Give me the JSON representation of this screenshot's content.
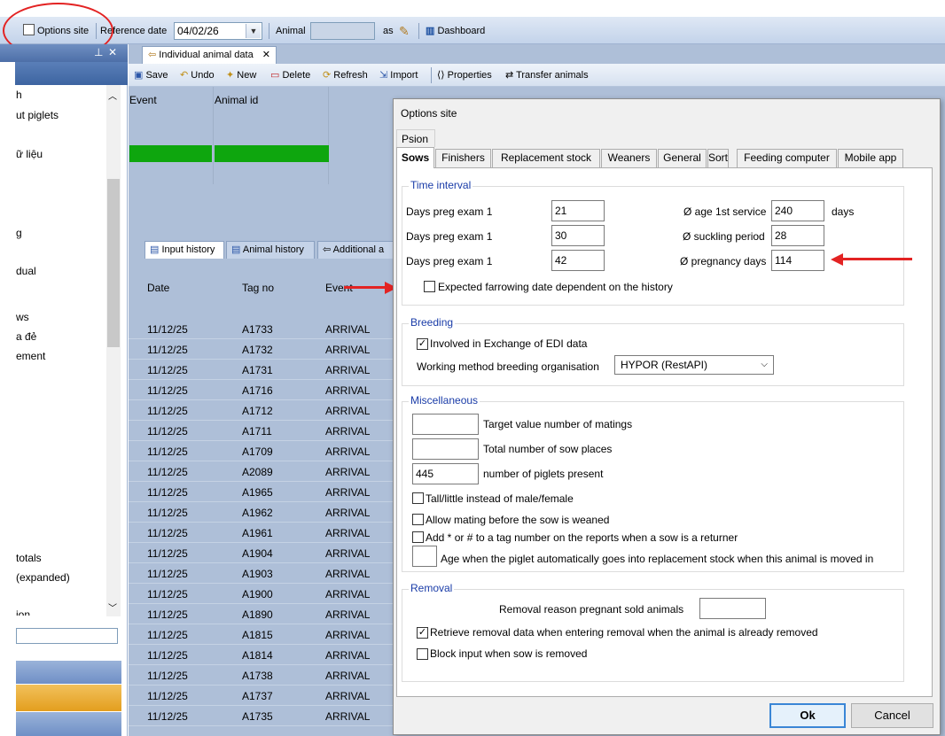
{
  "toolbar": {
    "options_site": "Options site",
    "reference_date_label": "Reference date",
    "reference_date_value": "04/02/26",
    "animal_label": "Animal",
    "animal_value": "",
    "as_label": "as",
    "dashboard": "Dashboard"
  },
  "left_panel": {
    "items": [
      "h",
      "ut piglets",
      "ữ liệu",
      "g",
      "dual",
      "ws",
      "a đẻ",
      "ement",
      "totals",
      "(expanded)",
      "ion"
    ]
  },
  "document": {
    "tab_title": "Individual animal data",
    "toolbar": {
      "save": "Save",
      "undo": "Undo",
      "new": "New",
      "delete": "Delete",
      "refresh": "Refresh",
      "import": "Import",
      "properties": "Properties",
      "transfer": "Transfer animals"
    },
    "grid_headers": {
      "event": "Event",
      "animal_id": "Animal id"
    },
    "sub_tabs": [
      "Input history",
      "Animal history",
      "Additional a"
    ],
    "history_headers": {
      "date": "Date",
      "tag_no": "Tag no",
      "event": "Event"
    },
    "history_rows": [
      {
        "date": "11/12/25",
        "tag": "A1733",
        "event": "ARRIVAL"
      },
      {
        "date": "11/12/25",
        "tag": "A1732",
        "event": "ARRIVAL"
      },
      {
        "date": "11/12/25",
        "tag": "A1731",
        "event": "ARRIVAL"
      },
      {
        "date": "11/12/25",
        "tag": "A1716",
        "event": "ARRIVAL"
      },
      {
        "date": "11/12/25",
        "tag": "A1712",
        "event": "ARRIVAL"
      },
      {
        "date": "11/12/25",
        "tag": "A1711",
        "event": "ARRIVAL"
      },
      {
        "date": "11/12/25",
        "tag": "A1709",
        "event": "ARRIVAL"
      },
      {
        "date": "11/12/25",
        "tag": "A2089",
        "event": "ARRIVAL"
      },
      {
        "date": "11/12/25",
        "tag": "A1965",
        "event": "ARRIVAL"
      },
      {
        "date": "11/12/25",
        "tag": "A1962",
        "event": "ARRIVAL"
      },
      {
        "date": "11/12/25",
        "tag": "A1961",
        "event": "ARRIVAL"
      },
      {
        "date": "11/12/25",
        "tag": "A1904",
        "event": "ARRIVAL"
      },
      {
        "date": "11/12/25",
        "tag": "A1903",
        "event": "ARRIVAL"
      },
      {
        "date": "11/12/25",
        "tag": "A1900",
        "event": "ARRIVAL"
      },
      {
        "date": "11/12/25",
        "tag": "A1890",
        "event": "ARRIVAL"
      },
      {
        "date": "11/12/25",
        "tag": "A1815",
        "event": "ARRIVAL"
      },
      {
        "date": "11/12/25",
        "tag": "A1814",
        "event": "ARRIVAL"
      },
      {
        "date": "11/12/25",
        "tag": "A1738",
        "event": "ARRIVAL"
      },
      {
        "date": "11/12/25",
        "tag": "A1737",
        "event": "ARRIVAL"
      },
      {
        "date": "11/12/25",
        "tag": "A1735",
        "event": "ARRIVAL"
      }
    ]
  },
  "dialog": {
    "title": "Options site",
    "psion_tab": "Psion",
    "tabs": [
      "Sows",
      "Finishers",
      "Replacement stock",
      "Weaners",
      "General",
      "Sort",
      "Feeding computer",
      "Mobile app"
    ],
    "time_interval": {
      "title": "Time interval",
      "rows": [
        {
          "label": "Days preg exam 1",
          "value": "21"
        },
        {
          "label": "Days preg exam 1",
          "value": "30"
        },
        {
          "label": "Days preg exam 1",
          "value": "42"
        }
      ],
      "right_rows": [
        {
          "label": "Ø age 1st service",
          "value": "240",
          "unit": "days"
        },
        {
          "label": "Ø suckling period",
          "value": "28",
          "unit": ""
        },
        {
          "label": "Ø pregnancy days",
          "value": "114",
          "unit": ""
        }
      ],
      "expected_farrowing": "Expected farrowing date dependent on the history"
    },
    "breeding": {
      "title": "Breeding",
      "edi_label": "Involved in Exchange of EDI data",
      "edi_checked": true,
      "working_method_label": "Working method breeding organisation",
      "working_method_value": "HYPOR (RestAPI)"
    },
    "misc": {
      "title": "Miscellaneous",
      "target_matings": "Target value number of matings",
      "target_matings_value": "",
      "total_places": "Total number of sow places",
      "total_places_value": "",
      "piglets_present": "number of piglets present",
      "piglets_present_value": "445",
      "tall_little": "Tall/little instead of male/female",
      "allow_mating": "Allow mating before the sow is weaned",
      "add_star": "Add * or # to a tag number on the reports when a sow is a returner",
      "age_piglet": "Age when the piglet automatically goes into replacement stock when this animal is moved in",
      "age_piglet_value": ""
    },
    "removal": {
      "title": "Removal",
      "reason_label": "Removal reason pregnant sold animals",
      "reason_value": "",
      "retrieve_label": "Retrieve removal data when entering removal when the animal is already removed",
      "retrieve_checked": true,
      "block_label": "Block input when sow is removed"
    },
    "ok": "Ok",
    "cancel": "Cancel"
  },
  "colors": {
    "annotation_red": "#e32323",
    "group_title": "#1a3ca8",
    "green_cell": "#0ea60e"
  }
}
